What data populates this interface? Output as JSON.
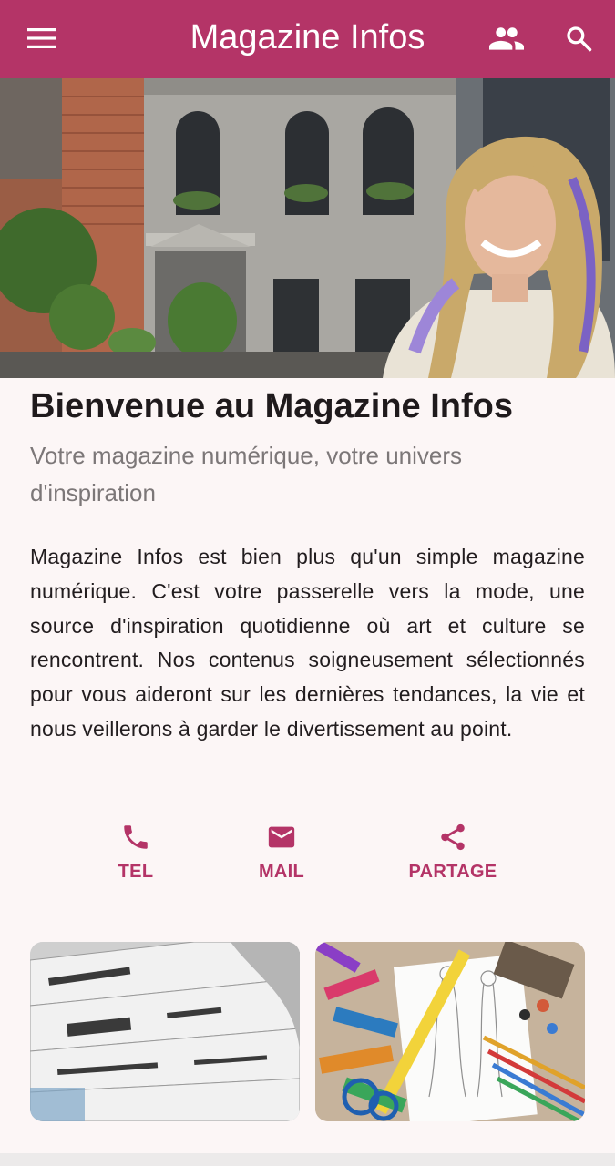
{
  "app_bar": {
    "title": "Magazine Infos",
    "menu_icon": "menu-icon",
    "people_icon": "people-icon",
    "search_icon": "search-icon",
    "color": "#b43467"
  },
  "hero": {
    "image": "storefront-woman-photo"
  },
  "content": {
    "headline": "Bienvenue au Magazine Infos",
    "subtitle": "Votre magazine numérique, votre univers d'inspiration",
    "body": "Magazine Infos est bien plus qu'un simple magazine numérique. C'est votre passerelle vers la mode, une source d'inspiration quotidienne où art et culture se rencontrent. Nos contenus soigneusement sélectionnés pour vous aideront sur les dernières tendances, la vie et nous veillerons à garder le divertissement au point."
  },
  "actions": [
    {
      "label": "TEL",
      "icon": "phone-icon"
    },
    {
      "label": "MAIL",
      "icon": "mail-icon"
    },
    {
      "label": "PARTAGE",
      "icon": "share-icon"
    }
  ],
  "thumbnails": [
    {
      "image": "newspapers-photo"
    },
    {
      "image": "fashion-sketch-photo"
    }
  ]
}
